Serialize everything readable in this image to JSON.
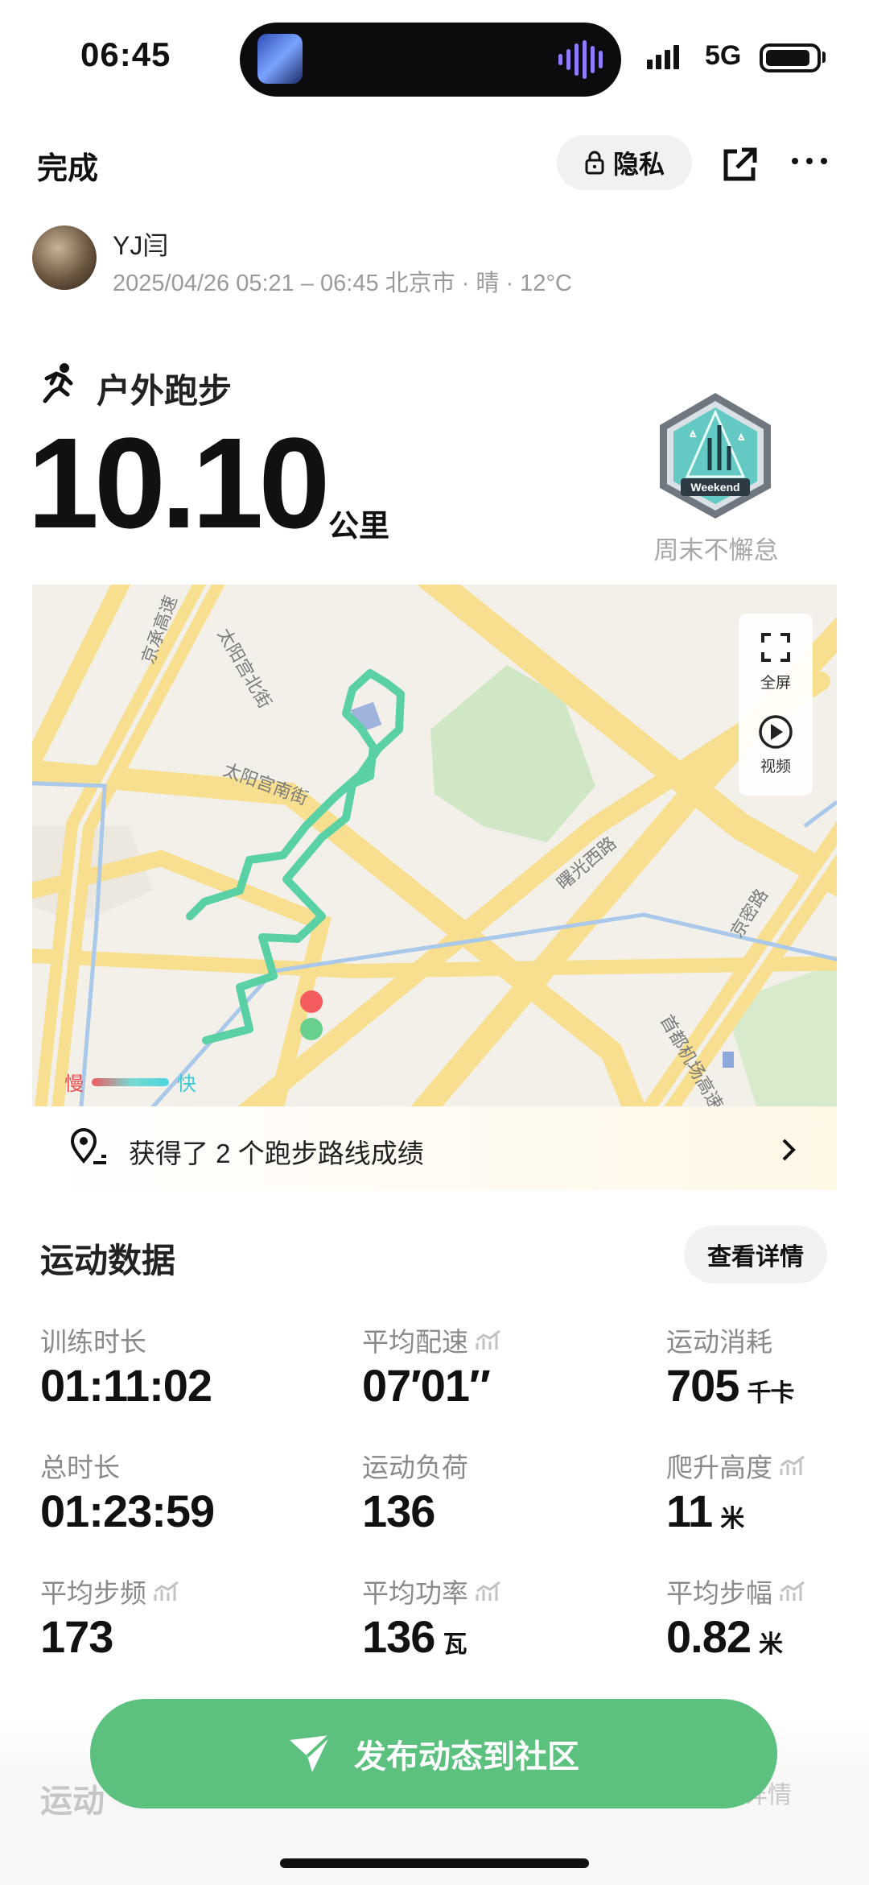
{
  "status_bar": {
    "time": "06:45",
    "network": "5G"
  },
  "header": {
    "done_label": "完成",
    "privacy_label": "隐私"
  },
  "user": {
    "name": "YJ闫",
    "meta": "2025/04/26 05:21 – 06:45 北京市 · 晴 · 12°C"
  },
  "activity": {
    "type_label": "户外跑步",
    "distance": "10.10",
    "distance_unit": "公里",
    "badge_text": "Weekend",
    "badge_label": "周末不懈怠"
  },
  "map": {
    "controls": {
      "fullscreen_label": "全屏",
      "video_label": "视频"
    },
    "legend": {
      "slow": "慢",
      "fast": "快"
    },
    "road_labels": [
      "京承高速",
      "太阳宫北街",
      "太阳宫南街",
      "曙光西路",
      "京密路",
      "首都机场高速"
    ],
    "route_color": "#5ad1a4"
  },
  "route_banner": {
    "text": "获得了 2 个跑步路线成绩"
  },
  "stats": {
    "title": "运动数据",
    "detail_label": "查看详情",
    "items": [
      {
        "label": "训练时长",
        "value": "01:11:02",
        "unit": ""
      },
      {
        "label": "平均配速",
        "value": "07′01″",
        "unit": ""
      },
      {
        "label": "运动消耗",
        "value": "705",
        "unit": "千卡"
      },
      {
        "label": "总时长",
        "value": "01:23:59",
        "unit": ""
      },
      {
        "label": "运动负荷",
        "value": "136",
        "unit": ""
      },
      {
        "label": "爬升高度",
        "value": "11",
        "unit": "米"
      },
      {
        "label": "平均步频",
        "value": "173",
        "unit": ""
      },
      {
        "label": "平均功率",
        "value": "136",
        "unit": "瓦"
      },
      {
        "label": "平均步幅",
        "value": "0.82",
        "unit": "米"
      }
    ]
  },
  "fab": {
    "label": "发布动态到社区"
  },
  "below": {
    "section_partial": "运动",
    "detail_partial": "详情"
  },
  "colors": {
    "accent_green": "#5cc17e",
    "map_road": "#f7df8f",
    "map_park": "#cfe7c4"
  }
}
